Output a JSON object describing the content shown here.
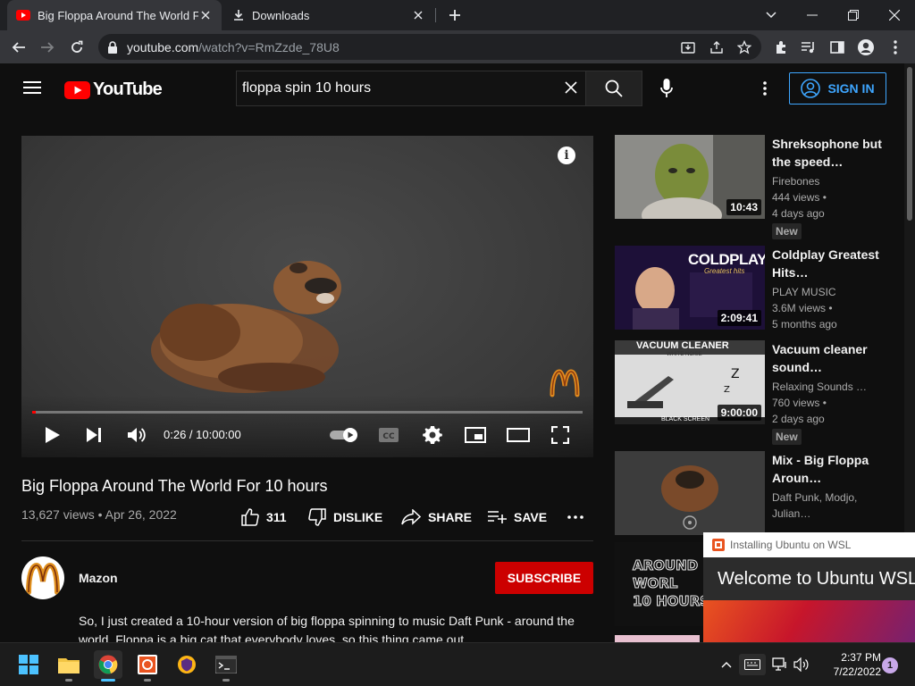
{
  "browser": {
    "tabs": [
      {
        "title": "Big Floppa Around The World For 10 hours"
      },
      {
        "title": "Downloads"
      }
    ],
    "url_host": "youtube.com",
    "url_path": "/watch?v=RmZzde_78U8"
  },
  "youtube": {
    "logo_text": "YouTube",
    "search_value": "floppa spin 10 hours",
    "signin_label": "SIGN IN"
  },
  "player": {
    "time": "0:26 / 10:00:00",
    "progress_fraction": 0.0007
  },
  "video": {
    "title": "Big Floppa Around The World For 10 hours",
    "meta": "13,627 views • Apr 26, 2022",
    "likes": "311",
    "dislike_label": "DISLIKE",
    "share_label": "SHARE",
    "save_label": "SAVE"
  },
  "channel": {
    "name": "Mazon",
    "subscribe_label": "SUBSCRIBE",
    "description": "So, I just created a 10-hour version of big floppa spinning to music Daft Punk - around the world. Floppa is a big cat that everybody loves, so this thing came out."
  },
  "recommendations": [
    {
      "title": "Shreksophone but the speed…",
      "channel": "Firebones",
      "views": "444 views •",
      "age": "4 days ago",
      "badge": "New",
      "duration": "10:43"
    },
    {
      "title": "Coldplay Greatest Hits…",
      "channel": "PLAY MUSIC",
      "views": "3.6M views •",
      "age": "5 months ago",
      "badge": "",
      "duration": "2:09:41",
      "thumb_text": "COLDPLAY",
      "thumb_sub": "Greatest hits"
    },
    {
      "title": "Vacuum cleaner sound…",
      "channel": "Relaxing Sounds …",
      "views": "760 views •",
      "age": "2 days ago",
      "badge": "New",
      "duration": "9:00:00",
      "thumb_text": "VACUUM CLEANER",
      "thumb_sub": "WHITE NOISE",
      "thumb_bottom": "BLACK SCREEN"
    },
    {
      "title": "Mix - Big Floppa Aroun…",
      "channel": "Daft Punk, Modjo,",
      "views": "Julian…",
      "age": "",
      "badge": "",
      "duration": ""
    },
    {
      "thumb_text": "AROUND\nWORL\n10 HOURS"
    }
  ],
  "wsl": {
    "window_title": "Installing Ubuntu on WSL",
    "heading": "Welcome to Ubuntu WSL"
  },
  "taskbar": {
    "time": "2:37 PM",
    "date": "7/22/2022",
    "notifications": "1"
  },
  "colors": {
    "yt_red": "#ff0000",
    "accent_blue": "#3ea6ff",
    "subscribe_red": "#cc0000"
  }
}
